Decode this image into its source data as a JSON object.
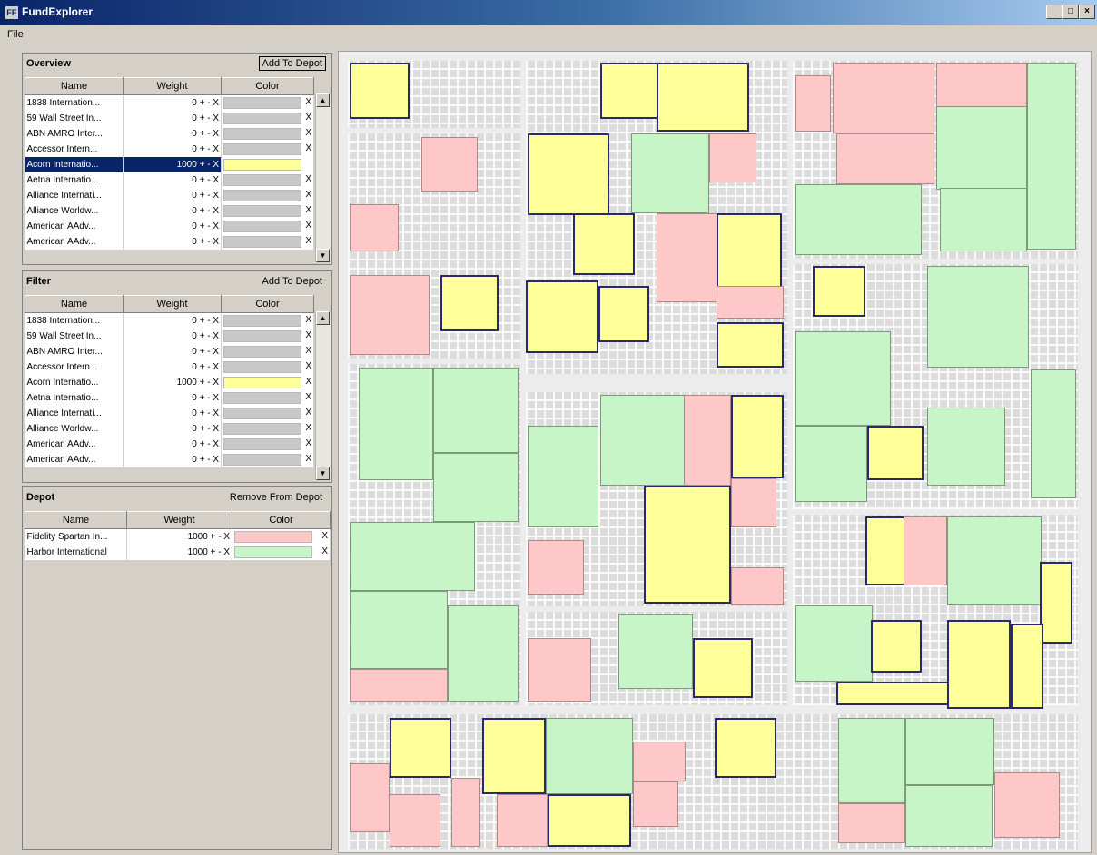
{
  "window": {
    "title": "FundExplorer",
    "icon_label": "FE"
  },
  "menubar": {
    "file": "File"
  },
  "panels": {
    "overview": {
      "title": "Overview",
      "button": "Add To Depot",
      "columns": [
        "Name",
        "Weight",
        "Color"
      ],
      "rows": [
        {
          "name": "1838 Internation...",
          "weight": "0",
          "controls": "+ - X",
          "color": "#c8c8c8",
          "x": "X"
        },
        {
          "name": "59 Wall Street In...",
          "weight": "0",
          "controls": "+ - X",
          "color": "#c8c8c8",
          "x": "X"
        },
        {
          "name": "ABN AMRO Inter...",
          "weight": "0",
          "controls": "+ - X",
          "color": "#c8c8c8",
          "x": "X"
        },
        {
          "name": "Accessor Intern...",
          "weight": "0",
          "controls": "+ - X",
          "color": "#c8c8c8",
          "x": "X"
        },
        {
          "name": "Acorn Internatio...",
          "weight": "1000",
          "controls": "+ - X",
          "color": "#ffff99",
          "x": "X",
          "selected": true
        },
        {
          "name": "Aetna Internatio...",
          "weight": "0",
          "controls": "+ - X",
          "color": "#c8c8c8",
          "x": "X"
        },
        {
          "name": "Alliance Internati...",
          "weight": "0",
          "controls": "+ - X",
          "color": "#c8c8c8",
          "x": "X"
        },
        {
          "name": "Alliance Worldw...",
          "weight": "0",
          "controls": "+ - X",
          "color": "#c8c8c8",
          "x": "X"
        },
        {
          "name": "American AAdv...",
          "weight": "0",
          "controls": "+ - X",
          "color": "#c8c8c8",
          "x": "X"
        },
        {
          "name": "American AAdv...",
          "weight": "0",
          "controls": "+ - X",
          "color": "#c8c8c8",
          "x": "X"
        }
      ]
    },
    "filter": {
      "title": "Filter",
      "button": "Add To Depot",
      "columns": [
        "Name",
        "Weight",
        "Color"
      ],
      "rows": [
        {
          "name": "1838 Internation...",
          "weight": "0",
          "controls": "+ - X",
          "color": "#c8c8c8",
          "x": "X"
        },
        {
          "name": "59 Wall Street In...",
          "weight": "0",
          "controls": "+ - X",
          "color": "#c8c8c8",
          "x": "X"
        },
        {
          "name": "ABN AMRO Inter...",
          "weight": "0",
          "controls": "+ - X",
          "color": "#c8c8c8",
          "x": "X"
        },
        {
          "name": "Accessor Intern...",
          "weight": "0",
          "controls": "+ - X",
          "color": "#c8c8c8",
          "x": "X"
        },
        {
          "name": "Acorn Internatio...",
          "weight": "1000",
          "controls": "+ - X",
          "color": "#ffff99",
          "x": "X"
        },
        {
          "name": "Aetna Internatio...",
          "weight": "0",
          "controls": "+ - X",
          "color": "#c8c8c8",
          "x": "X"
        },
        {
          "name": "Alliance Internati...",
          "weight": "0",
          "controls": "+ - X",
          "color": "#c8c8c8",
          "x": "X"
        },
        {
          "name": "Alliance Worldw...",
          "weight": "0",
          "controls": "+ - X",
          "color": "#c8c8c8",
          "x": "X"
        },
        {
          "name": "American AAdv...",
          "weight": "0",
          "controls": "+ - X",
          "color": "#c8c8c8",
          "x": "X"
        },
        {
          "name": "American AAdv...",
          "weight": "0",
          "controls": "+ - X",
          "color": "#c8c8c8",
          "x": "X"
        }
      ]
    },
    "depot": {
      "title": "Depot",
      "button": "Remove From Depot",
      "columns": [
        "Name",
        "Weight",
        "Color"
      ],
      "rows": [
        {
          "name": "Fidelity Spartan In...",
          "weight": "1000",
          "controls": "+ - X",
          "color": "#ffc8c8",
          "x": "X"
        },
        {
          "name": "Harbor International",
          "weight": "1000",
          "controls": "+ - X",
          "color": "#c8f5c8",
          "x": "X"
        }
      ]
    }
  },
  "colors": {
    "selected_row": "#0a246a",
    "acorn_yellow": "#ffff99",
    "fidelity_pink": "#ffc8c8",
    "harbor_green": "#c8f5c8",
    "neutral_gray": "#c8c8c8"
  },
  "treemap": {
    "fund_colors": [
      "yellow",
      "pink",
      "green"
    ],
    "tile_counts": {
      "yellow": 23,
      "pink": 21,
      "green": 27
    }
  }
}
